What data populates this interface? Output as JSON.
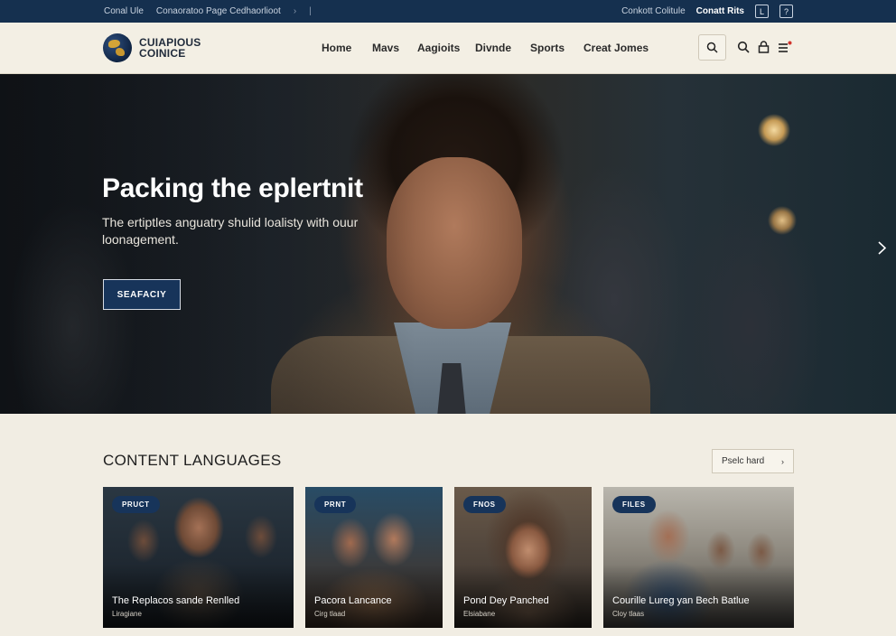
{
  "utility_bar": {
    "left_links": [
      "Conal Ule",
      "Conaoratoo Page Cedhaorlioot"
    ],
    "separator": "›",
    "divider": "|",
    "right_links": [
      "Conkott Colitule",
      "Conatt Rits"
    ],
    "box_icons": [
      "L",
      "?"
    ]
  },
  "header": {
    "logo_line1": "CUIAPIOUS",
    "logo_line2": "COINICE",
    "nav": [
      "Home",
      "Mavs",
      "Aagioits",
      "Divnde",
      "Sports",
      "Creat Jomes"
    ]
  },
  "hero": {
    "title": "Packing the eplertnit",
    "subtitle": "The ertiptles anguatry shulid loalisty with ouur loonagement.",
    "cta": "SEAFACIY"
  },
  "section": {
    "title": "CONTENT LANGUAGES",
    "select_label": "Pselc hard",
    "select_chevron": "›"
  },
  "cards": [
    {
      "badge": "PRUCT",
      "title": "The Replacos sande Renlled",
      "meta": "Liragiane"
    },
    {
      "badge": "PRNT",
      "title": "Pacora Lancance",
      "meta": "Cirg tlaad"
    },
    {
      "badge": "FNOS",
      "title": "Pond Dey Panched",
      "meta": "Elsiabane"
    },
    {
      "badge": "FILES",
      "title": "Courille Lureg yan Bech Batlue",
      "meta": "Cloy tlaas"
    }
  ],
  "colors": {
    "navy": "#15304f",
    "accent": "#17345a",
    "background": "#f1ede3"
  }
}
